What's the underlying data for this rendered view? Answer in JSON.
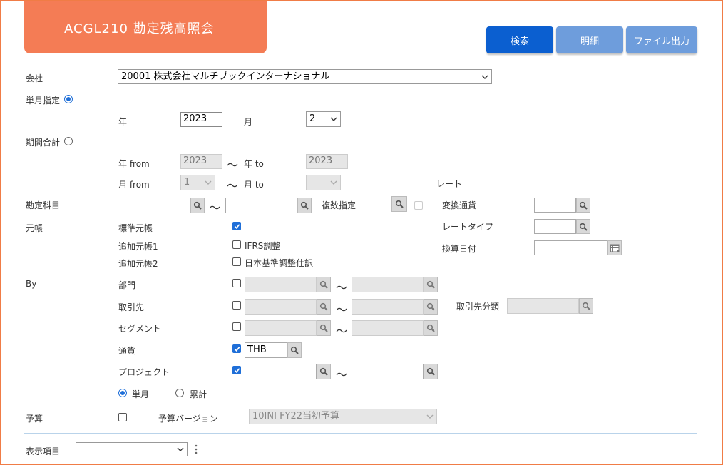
{
  "title": "ACGL210 勘定残高照会",
  "buttons": {
    "search": "検索",
    "detail": "明細",
    "file_output": "ファイル出力"
  },
  "colors": {
    "title_bg": "#f47c55",
    "primary": "#0b5fd0",
    "disabled_btn": "#6e9ddc",
    "frame": "#f07c46"
  },
  "company": {
    "label": "会社",
    "value": "20001 株式会社マルチブックインターナショナル"
  },
  "single_month": {
    "label": "単月指定",
    "selected": true,
    "year_label": "年",
    "year": "2023",
    "month_label": "月",
    "month": "2"
  },
  "period_total": {
    "label": "期間合計",
    "selected": false,
    "year_from_label": "年 from",
    "year_from": "2023",
    "year_to_label": "年 to",
    "year_to": "2023",
    "month_from_label": "月 from",
    "month_from": "1",
    "month_to_label": "月 to",
    "month_to": ""
  },
  "tilde": "〜",
  "rate": {
    "label": "レート",
    "conv_currency": "変換通貨",
    "rate_type": "レートタイプ",
    "conv_date": "換算日付"
  },
  "account": {
    "label": "勘定科目",
    "multi": "複数指定"
  },
  "ledger": {
    "label": "元帳",
    "std": "標準元帳",
    "add1": "追加元帳1",
    "ifrs": "IFRS調整",
    "add2": "追加元帳2",
    "jp": "日本基準調整仕訳"
  },
  "by": {
    "label": "By",
    "dept": "部門",
    "partner": "取引先",
    "partner_class": "取引先分類",
    "segment": "セグメント",
    "currency": "通貨",
    "currency_value": "THB",
    "project": "プロジェクト",
    "single": "単月",
    "cumulative": "累計"
  },
  "budget": {
    "label": "予算",
    "version_label": "予算バージョン",
    "version": "10INI FY22当初予算"
  },
  "display": {
    "label": "表示項目",
    "value": ""
  }
}
